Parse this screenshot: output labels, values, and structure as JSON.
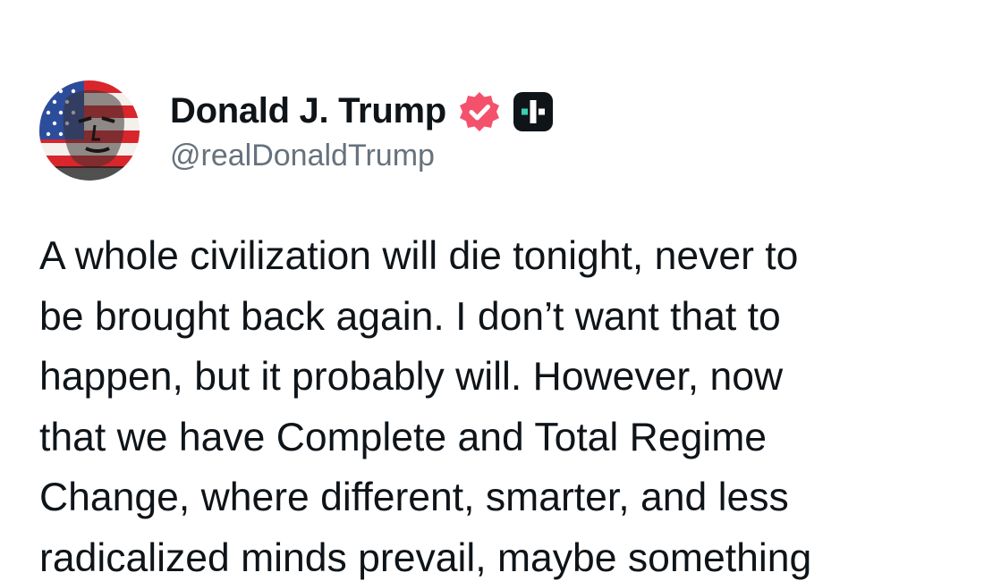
{
  "author": {
    "display_name": "Donald J. Trump",
    "handle": "@realDonaldTrump",
    "verified_icon": "verified-badge-icon",
    "verified_color": "#f4516c",
    "app_icon": "plus-icon",
    "app_icon_color": "#0f1419",
    "app_icon_accent": "#3ad0b0",
    "avatar_icon": "avatar-flag-portrait"
  },
  "post": {
    "lines": [
      "A whole civilization will die tonight, never to",
      "be brought back again. I don’t want that to",
      "happen, but it probably will. However, now",
      "that we have Complete and Total Regime",
      "Change, where different, smarter, and less",
      "radicalized minds prevail, maybe something"
    ]
  }
}
